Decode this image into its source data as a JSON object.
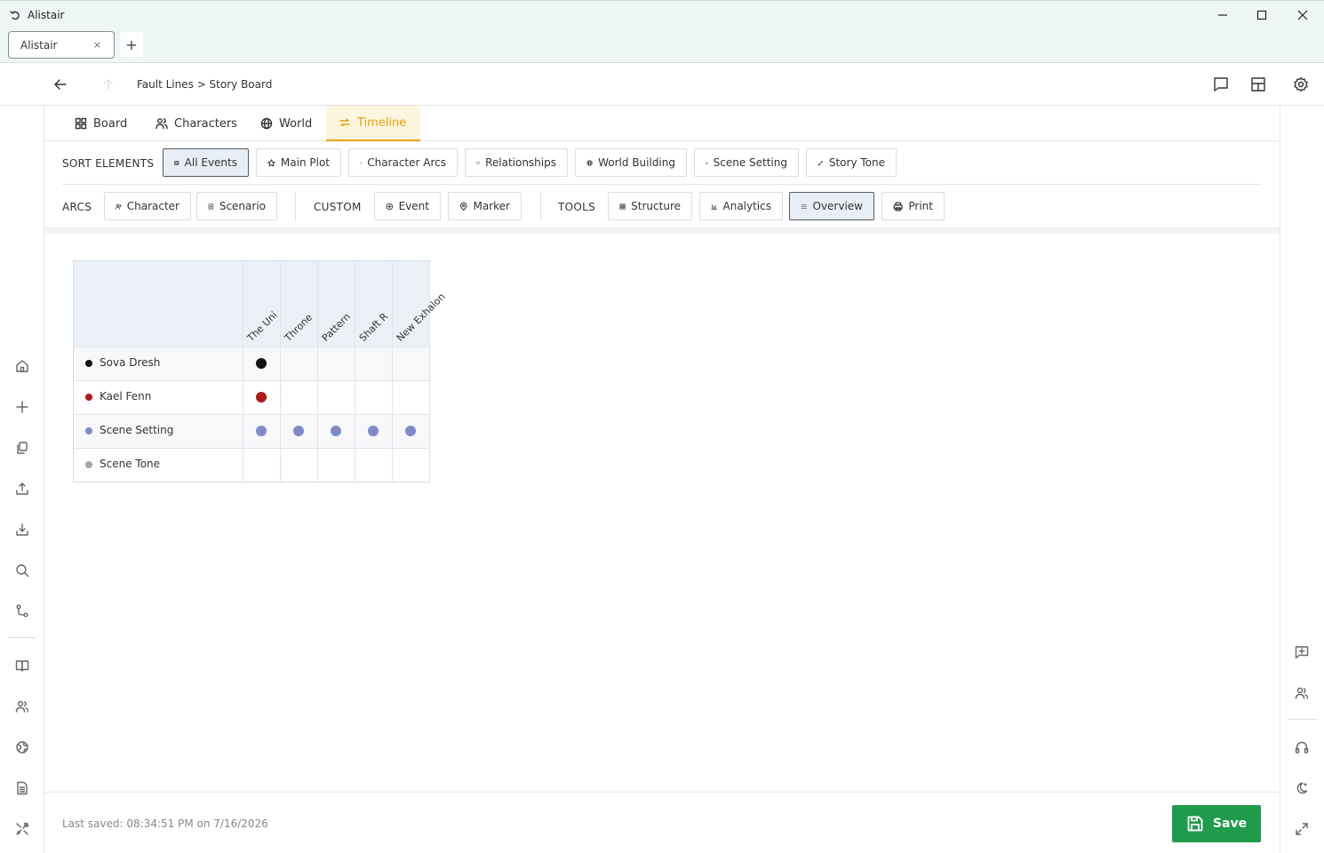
{
  "window": {
    "title": "Alistair"
  },
  "tabs": {
    "active_label": "Alistair",
    "close_glyph": "×",
    "new_glyph": "+"
  },
  "nav": {
    "breadcrumb": "Fault Lines > Story Board"
  },
  "main_tabs": [
    {
      "label": "Board",
      "icon": "grid-icon"
    },
    {
      "label": "Characters",
      "icon": "users-icon"
    },
    {
      "label": "World",
      "icon": "globe-icon"
    },
    {
      "label": "Timeline",
      "icon": "swap-icon",
      "active": true
    }
  ],
  "sort": {
    "label": "SORT ELEMENTS",
    "buttons": [
      "All Events",
      "Main Plot",
      "Character Arcs",
      "Relationships",
      "World Building",
      "Scene Setting",
      "Story Tone"
    ],
    "selected": "All Events"
  },
  "arcs": {
    "label": "ARCS",
    "buttons": [
      "Character",
      "Scenario"
    ]
  },
  "custom": {
    "label": "CUSTOM",
    "buttons": [
      "Event",
      "Marker"
    ]
  },
  "tools": {
    "label": "TOOLS",
    "buttons": [
      "Structure",
      "Analytics",
      "Overview",
      "Print"
    ],
    "selected": "Overview"
  },
  "matrix": {
    "columns": [
      "The Uni",
      "Throne",
      "Pattern",
      "Shaft R",
      "New Exhalon"
    ],
    "rows": [
      {
        "label": "Sova Dresh",
        "color": "#111111",
        "cells": [
          true,
          false,
          false,
          false,
          false
        ]
      },
      {
        "label": "Kael Fenn",
        "color": "#b01818",
        "cells": [
          true,
          false,
          false,
          false,
          false
        ]
      },
      {
        "label": "Scene Setting",
        "color": "#7d8cc8",
        "cells": [
          true,
          true,
          true,
          true,
          true
        ]
      },
      {
        "label": "Scene Tone",
        "color": "#a8a8a8",
        "cells": [
          false,
          false,
          false,
          false,
          false
        ]
      }
    ]
  },
  "footer": {
    "last_saved": "Last saved: 08:34:51 PM on 7/16/2026",
    "save_label": "Save"
  },
  "colors": {
    "accent": "#e6a20c",
    "save": "#1e9b4b"
  }
}
